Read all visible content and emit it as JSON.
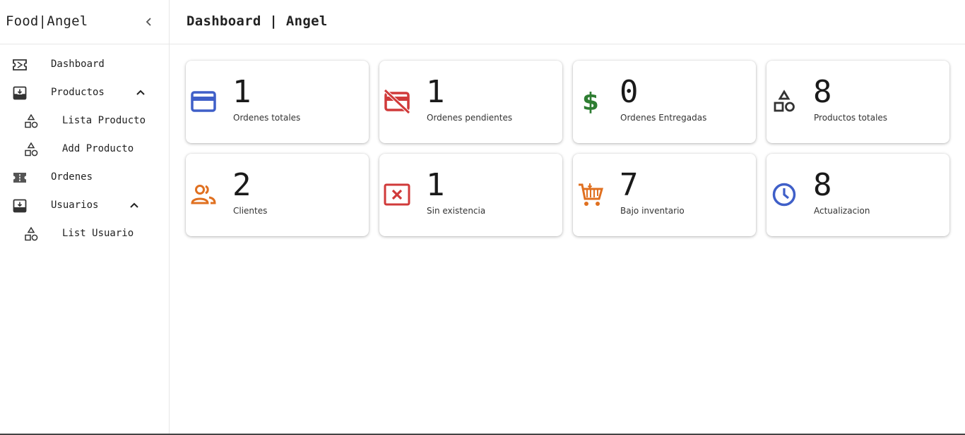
{
  "sidebar": {
    "brand": "Food|Angel",
    "items": [
      {
        "label": "Dashboard",
        "icon": "ticket-icon"
      },
      {
        "label": "Productos",
        "icon": "inbox-icon",
        "expanded": true
      },
      {
        "label": "Lista Producto",
        "icon": "category-icon"
      },
      {
        "label": "Add Producto",
        "icon": "category-icon"
      },
      {
        "label": "Ordenes",
        "icon": "ticket-filled-icon"
      },
      {
        "label": "Usuarios",
        "icon": "inbox-icon",
        "expanded": true
      },
      {
        "label": "List Usuario",
        "icon": "category-icon"
      }
    ]
  },
  "header": {
    "title": "Dashboard | Angel"
  },
  "cards": [
    {
      "value": "1",
      "label": "Ordenes totales",
      "icon": "credit-card-icon",
      "color": "#3f5fc8"
    },
    {
      "value": "1",
      "label": "Ordenes pendientes",
      "icon": "credit-card-off-icon",
      "color": "#d03a3a"
    },
    {
      "value": "0",
      "label": "Ordenes Entregadas",
      "icon": "dollar-icon",
      "color": "#2e7d32"
    },
    {
      "value": "8",
      "label": "Productos totales",
      "icon": "category-icon",
      "color": "#333333"
    },
    {
      "value": "2",
      "label": "Clientes",
      "icon": "people-icon",
      "color": "#e07020"
    },
    {
      "value": "1",
      "label": "Sin existencia",
      "icon": "disabled-x-icon",
      "color": "#d03a3a"
    },
    {
      "value": "7",
      "label": "Bajo inventario",
      "icon": "cart-icon",
      "color": "#e07020"
    },
    {
      "value": "8",
      "label": "Actualizacion",
      "icon": "clock-icon",
      "color": "#3f5fc8"
    }
  ]
}
